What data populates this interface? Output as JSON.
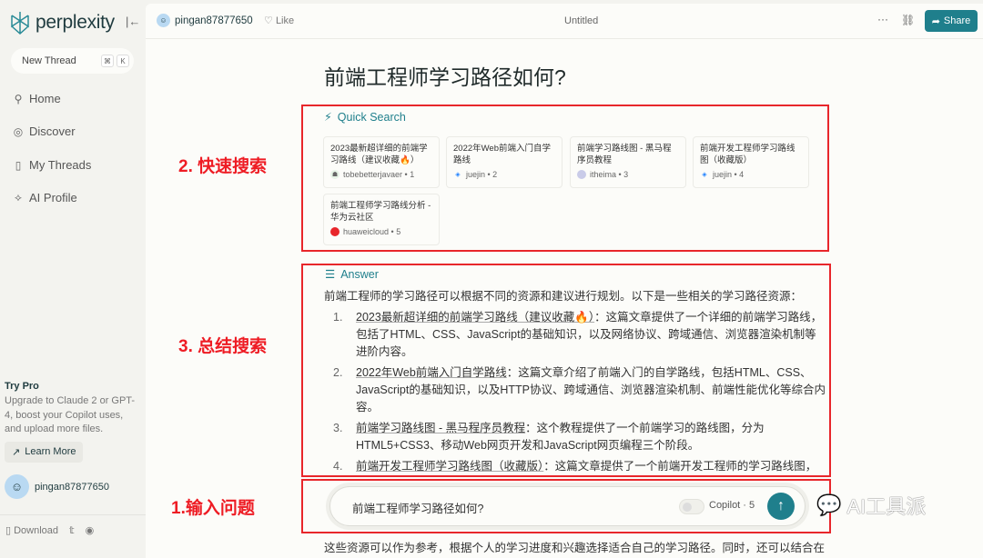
{
  "app": {
    "name": "perplexity"
  },
  "sidebar": {
    "new_thread": "New Thread",
    "kbd": [
      "⌘",
      "K"
    ],
    "nav": [
      {
        "label": "Home",
        "icon": "search-icon"
      },
      {
        "label": "Discover",
        "icon": "compass-icon"
      },
      {
        "label": "My Threads",
        "icon": "threads-icon"
      },
      {
        "label": "AI Profile",
        "icon": "profile-icon"
      }
    ],
    "try_pro": {
      "title": "Try Pro",
      "desc": "Upgrade to Claude 2 or GPT-4, boost your Copilot uses, and upload more files.",
      "button": "Learn More"
    },
    "user": "pingan87877650",
    "download": "Download"
  },
  "header": {
    "user": "pingan87877650",
    "like": "Like",
    "title": "Untitled",
    "share": "Share"
  },
  "question": "前端工程师学习路径如何?",
  "quick_search": {
    "title": "Quick Search",
    "sources": [
      {
        "title": "2023最新超详细的前端学习路线（建议收藏🔥）",
        "site": "tobebetterjavaer • 1"
      },
      {
        "title": "2022年Web前端入门自学路线",
        "site": "juejin • 2"
      },
      {
        "title": "前端学习路线图 - 黑马程序员教程",
        "site": "itheima • 3"
      },
      {
        "title": "前端开发工程师学习路线图（收藏版）",
        "site": "juejin • 4"
      },
      {
        "title": "前端工程师学习路线分析 - 华为云社区",
        "site": "huaweicloud • 5"
      }
    ]
  },
  "answer": {
    "title": "Answer",
    "intro": "前端工程师的学习路径可以根据不同的资源和建议进行规划。以下是一些相关的学习路径资源：",
    "items": [
      {
        "n": "1.",
        "link": "2023最新超详细的前端学习路线（建议收藏🔥）",
        "text": "：这篇文章提供了一个详细的前端学习路线，包括了HTML、CSS、JavaScript的基础知识，以及网络协议、跨域通信、浏览器渲染机制等进阶内容。"
      },
      {
        "n": "2.",
        "link": "2022年Web前端入门自学路线",
        "text": "：这篇文章介绍了前端入门的自学路线，包括HTML、CSS、JavaScript的基础知识，以及HTTP协议、跨域通信、浏览器渲染机制、前端性能优化等综合内容。"
      },
      {
        "n": "3.",
        "link": "前端学习路线图 - 黑马程序员教程",
        "text": "：这个教程提供了一个前端学习的路线图，分为HTML5+CSS3、移动Web网页开发和JavaScript网页编程三个阶段。"
      },
      {
        "n": "4.",
        "link": "前端开发工程师学习路线图（收藏版）",
        "text": "：这篇文章提供了一个前端开发工程师的学习路线图，"
      }
    ],
    "outro": "这些资源可以作为参考，根据个人的学习进度和兴趣选择适合自己的学习路径。同时，还可以结合在"
  },
  "input": {
    "value": "前端工程师学习路径如何?",
    "copilot": "Copilot · 5"
  },
  "annotations": {
    "step1": "1.输入问题",
    "step2": "2. 快速搜索",
    "step3": "3. 总结搜索"
  },
  "watermark": "AI工具派",
  "colors": {
    "accent": "#1f7f8c",
    "annotation": "#ee1c24"
  }
}
